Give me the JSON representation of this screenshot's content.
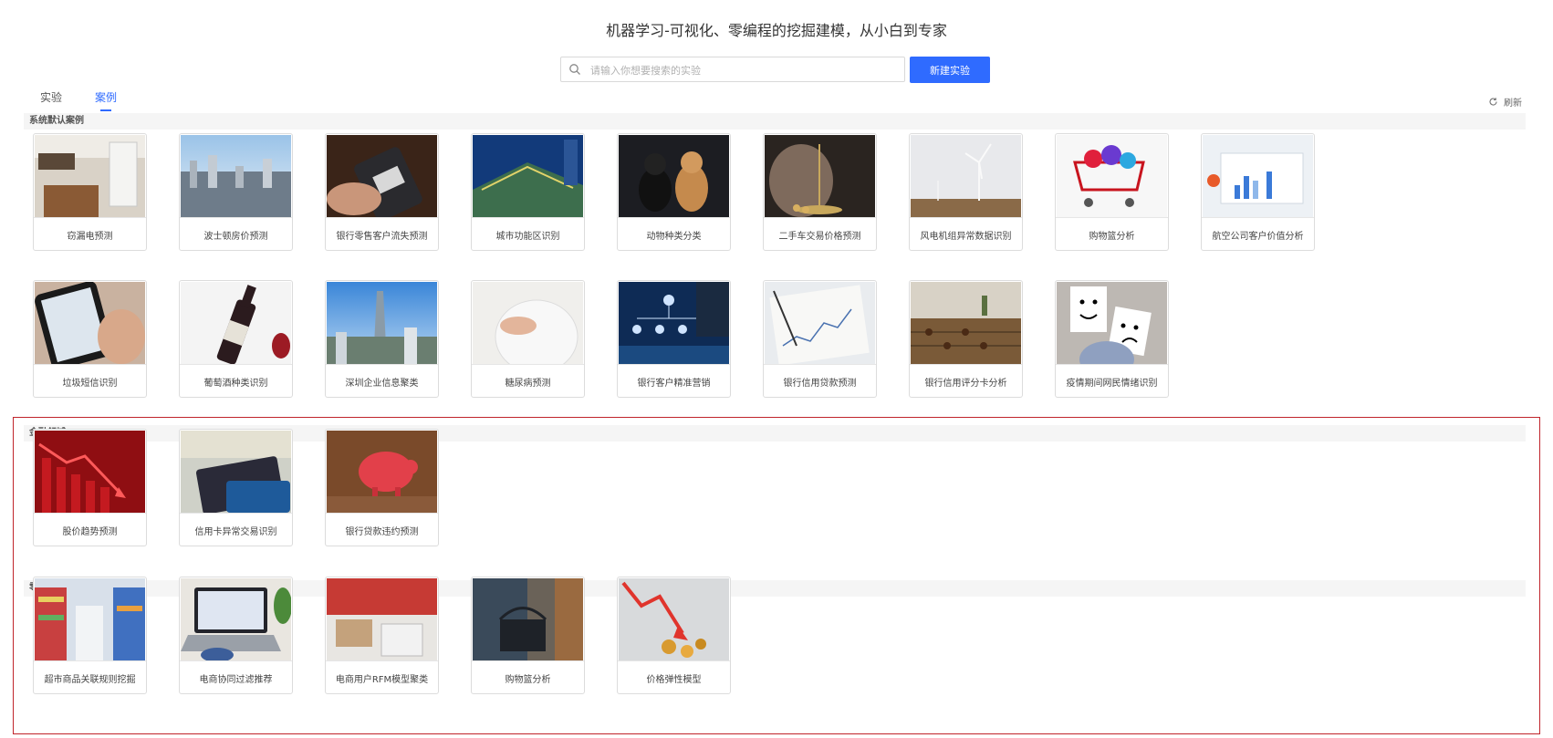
{
  "header": {
    "title": "机器学习-可视化、零编程的挖掘建模，从小白到专家",
    "search_placeholder": "请输入你想要搜索的实验",
    "new_button": "新建实验"
  },
  "tabs": [
    {
      "label": "实验"
    },
    {
      "label": "案例"
    }
  ],
  "refresh_label": "刷新",
  "sections": {
    "default": {
      "title": "系统默认案例",
      "cards": [
        {
          "label": "窃漏电预测",
          "icon": "kitchen-photo"
        },
        {
          "label": "波士顿房价预测",
          "icon": "city-skyline-photo"
        },
        {
          "label": "银行零售客户流失预测",
          "icon": "card-terminal-photo"
        },
        {
          "label": "城市功能区识别",
          "icon": "building-photo"
        },
        {
          "label": "动物种类分类",
          "icon": "dogs-photo"
        },
        {
          "label": "二手车交易价格预测",
          "icon": "scale-photo"
        },
        {
          "label": "风电机组异常数据识别",
          "icon": "wind-turbine-photo"
        },
        {
          "label": "购物篮分析",
          "icon": "shopping-cart-photo"
        },
        {
          "label": "航空公司客户价值分析",
          "icon": "chart-screen-photo"
        },
        {
          "label": "垃圾短信识别",
          "icon": "phone-sms-photo"
        },
        {
          "label": "葡萄酒种类识别",
          "icon": "wine-bottle-photo"
        },
        {
          "label": "深圳企业信息聚类",
          "icon": "skyscraper-photo"
        },
        {
          "label": "糖尿病预测",
          "icon": "body-photo"
        },
        {
          "label": "银行客户精准营销",
          "icon": "network-photo"
        },
        {
          "label": "银行信用贷款预测",
          "icon": "newspaper-photo"
        },
        {
          "label": "银行信用评分卡分析",
          "icon": "abacus-photo"
        },
        {
          "label": "疫情期间网民情绪识别",
          "icon": "faces-photo"
        }
      ]
    },
    "finance": {
      "title": "金融领域",
      "cards": [
        {
          "label": "股价趋势预测",
          "icon": "down-trend-photo"
        },
        {
          "label": "信用卡异常交易识别",
          "icon": "credit-card-photo"
        },
        {
          "label": "银行贷款违约预测",
          "icon": "piggy-bank-photo"
        }
      ]
    },
    "retail": {
      "title": "零售与电商领域",
      "cards": [
        {
          "label": "超市商品关联规则挖掘",
          "icon": "supermarket-photo"
        },
        {
          "label": "电商协同过滤推荐",
          "icon": "laptop-photo"
        },
        {
          "label": "电商用户RFM模型聚类",
          "icon": "packages-photo"
        },
        {
          "label": "购物篮分析",
          "icon": "basket-photo"
        },
        {
          "label": "价格弹性模型",
          "icon": "coins-arrow-photo"
        }
      ]
    }
  },
  "colors": {
    "accent": "#2f6bff",
    "highlight_border": "#c0242b",
    "section_bg": "#f5f5f5"
  }
}
